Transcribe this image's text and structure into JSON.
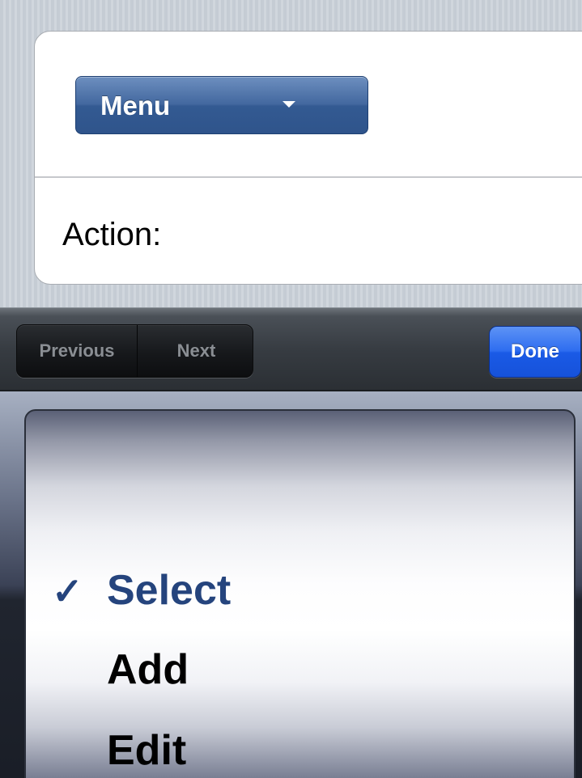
{
  "form": {
    "menu_label": "Menu",
    "action_label": "Action:"
  },
  "toolbar": {
    "previous_label": "Previous",
    "next_label": "Next",
    "done_label": "Done"
  },
  "picker": {
    "options": [
      {
        "label": "Select",
        "selected": true
      },
      {
        "label": "Add",
        "selected": false
      },
      {
        "label": "Edit",
        "selected": false
      }
    ],
    "check_glyph": "✓"
  },
  "colors": {
    "selected_text": "#25447d",
    "done_button": "#2e6df0",
    "menu_button": "#43689f"
  }
}
